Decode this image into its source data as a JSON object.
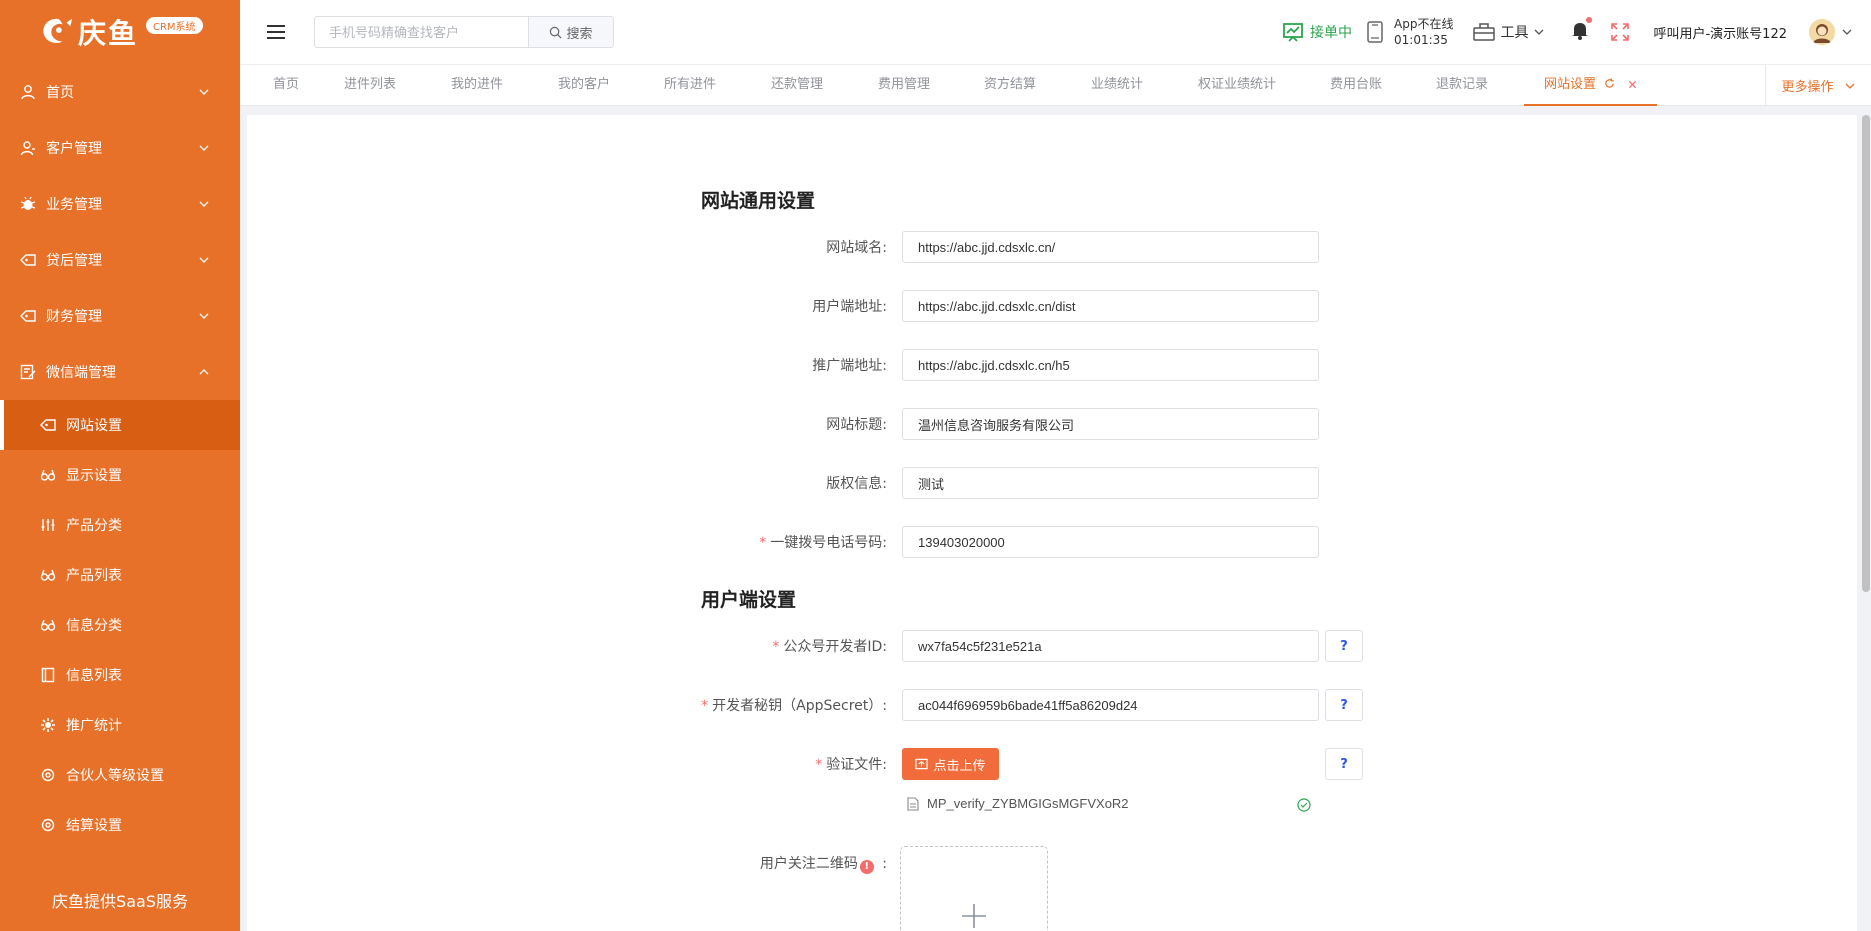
{
  "sidebar": {
    "logo_text": "庆鱼",
    "crm_badge": "CRM系统",
    "menu": [
      {
        "label": "首页"
      },
      {
        "label": "客户管理"
      },
      {
        "label": "业务管理"
      },
      {
        "label": "贷后管理"
      },
      {
        "label": "财务管理"
      },
      {
        "label": "微信端管理"
      }
    ],
    "submenu": [
      {
        "label": "网站设置"
      },
      {
        "label": "显示设置"
      },
      {
        "label": "产品分类"
      },
      {
        "label": "产品列表"
      },
      {
        "label": "信息分类"
      },
      {
        "label": "信息列表"
      },
      {
        "label": "推广统计"
      },
      {
        "label": "合伙人等级设置"
      },
      {
        "label": "结算设置"
      }
    ],
    "footer": "庆鱼提供SaaS服务"
  },
  "header": {
    "search_placeholder": "手机号码精确查找客户",
    "search_button": "搜索",
    "accept_label": "接单中",
    "app_status_line1": "App不在线",
    "app_status_line2": "01:01:35",
    "tools_label": "工具",
    "user_name": "呼叫用户-演示账号122"
  },
  "tabs": {
    "items": [
      "首页",
      "进件列表",
      "我的进件",
      "我的客户",
      "所有进件",
      "还款管理",
      "费用管理",
      "资方结算",
      "业绩统计",
      "权证业绩统计",
      "费用台账",
      "退款记录"
    ],
    "active": "网站设置",
    "more": "更多操作"
  },
  "form": {
    "general_title": "网站通用设置",
    "client_title": "用户端设置",
    "fields": {
      "domain": {
        "label": "网站域名:",
        "value": "https://abc.jjd.cdsxlc.cn/"
      },
      "client_url": {
        "label": "用户端地址:",
        "value": "https://abc.jjd.cdsxlc.cn/dist"
      },
      "promo_url": {
        "label": "推广端地址:",
        "value": "https://abc.jjd.cdsxlc.cn/h5"
      },
      "site_title": {
        "label": "网站标题:",
        "value": "温州信息咨询服务有限公司"
      },
      "copyright": {
        "label": "版权信息:",
        "value": "测试"
      },
      "phone": {
        "label": "一键拨号电话号码:",
        "value": "139403020000"
      },
      "appid": {
        "label": "公众号开发者ID:",
        "value": "wx7fa54c5f231e521a"
      },
      "secret": {
        "label": "开发者秘钥（AppSecret）:",
        "value": "ac044f696959b6bade41ff5a86209d24"
      },
      "verify_file": {
        "label": "验证文件:",
        "button": "点击上传",
        "file_name": "MP_verify_ZYBMGIGsMGFVXoR2"
      },
      "qr_code": {
        "label": "用户关注二维码",
        "colon": ":"
      }
    },
    "required_mark": "*",
    "help_mark": "?",
    "warn_mark": "!"
  },
  "colors": {
    "brand": "#e8712a",
    "brand_dark": "#d85e14",
    "upload": "#f26b3a",
    "success": "#2da44e",
    "danger": "#f56c6c"
  },
  "icons": [
    "search-icon",
    "hamburger-icon",
    "chart-icon",
    "phone-icon",
    "toolbox-icon",
    "bell-icon",
    "fullscreen-icon",
    "avatar-icon",
    "chevron-down-icon",
    "refresh-icon",
    "close-icon",
    "upload-icon",
    "file-icon",
    "check-circle-icon",
    "plus-icon"
  ]
}
